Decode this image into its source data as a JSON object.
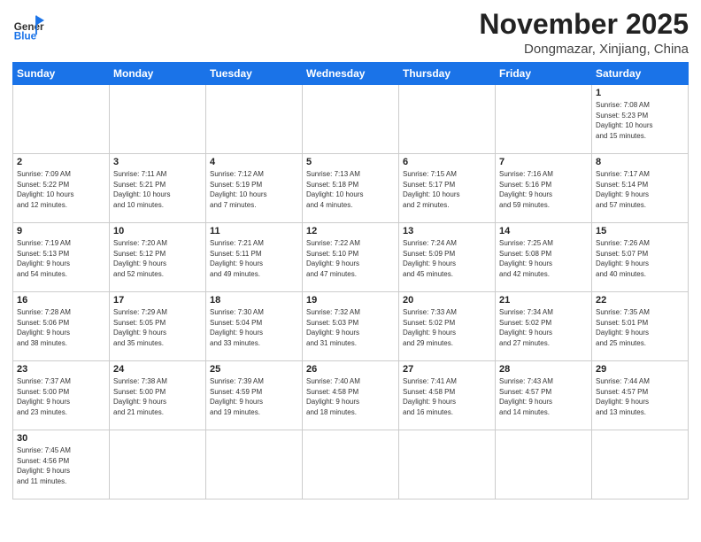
{
  "logo": {
    "text_general": "General",
    "text_blue": "Blue"
  },
  "title": "November 2025",
  "location": "Dongmazar, Xinjiang, China",
  "weekdays": [
    "Sunday",
    "Monday",
    "Tuesday",
    "Wednesday",
    "Thursday",
    "Friday",
    "Saturday"
  ],
  "weeks": [
    [
      {
        "day": "",
        "info": ""
      },
      {
        "day": "",
        "info": ""
      },
      {
        "day": "",
        "info": ""
      },
      {
        "day": "",
        "info": ""
      },
      {
        "day": "",
        "info": ""
      },
      {
        "day": "",
        "info": ""
      },
      {
        "day": "1",
        "info": "Sunrise: 7:08 AM\nSunset: 5:23 PM\nDaylight: 10 hours\nand 15 minutes."
      }
    ],
    [
      {
        "day": "2",
        "info": "Sunrise: 7:09 AM\nSunset: 5:22 PM\nDaylight: 10 hours\nand 12 minutes."
      },
      {
        "day": "3",
        "info": "Sunrise: 7:11 AM\nSunset: 5:21 PM\nDaylight: 10 hours\nand 10 minutes."
      },
      {
        "day": "4",
        "info": "Sunrise: 7:12 AM\nSunset: 5:19 PM\nDaylight: 10 hours\nand 7 minutes."
      },
      {
        "day": "5",
        "info": "Sunrise: 7:13 AM\nSunset: 5:18 PM\nDaylight: 10 hours\nand 4 minutes."
      },
      {
        "day": "6",
        "info": "Sunrise: 7:15 AM\nSunset: 5:17 PM\nDaylight: 10 hours\nand 2 minutes."
      },
      {
        "day": "7",
        "info": "Sunrise: 7:16 AM\nSunset: 5:16 PM\nDaylight: 9 hours\nand 59 minutes."
      },
      {
        "day": "8",
        "info": "Sunrise: 7:17 AM\nSunset: 5:14 PM\nDaylight: 9 hours\nand 57 minutes."
      }
    ],
    [
      {
        "day": "9",
        "info": "Sunrise: 7:19 AM\nSunset: 5:13 PM\nDaylight: 9 hours\nand 54 minutes."
      },
      {
        "day": "10",
        "info": "Sunrise: 7:20 AM\nSunset: 5:12 PM\nDaylight: 9 hours\nand 52 minutes."
      },
      {
        "day": "11",
        "info": "Sunrise: 7:21 AM\nSunset: 5:11 PM\nDaylight: 9 hours\nand 49 minutes."
      },
      {
        "day": "12",
        "info": "Sunrise: 7:22 AM\nSunset: 5:10 PM\nDaylight: 9 hours\nand 47 minutes."
      },
      {
        "day": "13",
        "info": "Sunrise: 7:24 AM\nSunset: 5:09 PM\nDaylight: 9 hours\nand 45 minutes."
      },
      {
        "day": "14",
        "info": "Sunrise: 7:25 AM\nSunset: 5:08 PM\nDaylight: 9 hours\nand 42 minutes."
      },
      {
        "day": "15",
        "info": "Sunrise: 7:26 AM\nSunset: 5:07 PM\nDaylight: 9 hours\nand 40 minutes."
      }
    ],
    [
      {
        "day": "16",
        "info": "Sunrise: 7:28 AM\nSunset: 5:06 PM\nDaylight: 9 hours\nand 38 minutes."
      },
      {
        "day": "17",
        "info": "Sunrise: 7:29 AM\nSunset: 5:05 PM\nDaylight: 9 hours\nand 35 minutes."
      },
      {
        "day": "18",
        "info": "Sunrise: 7:30 AM\nSunset: 5:04 PM\nDaylight: 9 hours\nand 33 minutes."
      },
      {
        "day": "19",
        "info": "Sunrise: 7:32 AM\nSunset: 5:03 PM\nDaylight: 9 hours\nand 31 minutes."
      },
      {
        "day": "20",
        "info": "Sunrise: 7:33 AM\nSunset: 5:02 PM\nDaylight: 9 hours\nand 29 minutes."
      },
      {
        "day": "21",
        "info": "Sunrise: 7:34 AM\nSunset: 5:02 PM\nDaylight: 9 hours\nand 27 minutes."
      },
      {
        "day": "22",
        "info": "Sunrise: 7:35 AM\nSunset: 5:01 PM\nDaylight: 9 hours\nand 25 minutes."
      }
    ],
    [
      {
        "day": "23",
        "info": "Sunrise: 7:37 AM\nSunset: 5:00 PM\nDaylight: 9 hours\nand 23 minutes."
      },
      {
        "day": "24",
        "info": "Sunrise: 7:38 AM\nSunset: 5:00 PM\nDaylight: 9 hours\nand 21 minutes."
      },
      {
        "day": "25",
        "info": "Sunrise: 7:39 AM\nSunset: 4:59 PM\nDaylight: 9 hours\nand 19 minutes."
      },
      {
        "day": "26",
        "info": "Sunrise: 7:40 AM\nSunset: 4:58 PM\nDaylight: 9 hours\nand 18 minutes."
      },
      {
        "day": "27",
        "info": "Sunrise: 7:41 AM\nSunset: 4:58 PM\nDaylight: 9 hours\nand 16 minutes."
      },
      {
        "day": "28",
        "info": "Sunrise: 7:43 AM\nSunset: 4:57 PM\nDaylight: 9 hours\nand 14 minutes."
      },
      {
        "day": "29",
        "info": "Sunrise: 7:44 AM\nSunset: 4:57 PM\nDaylight: 9 hours\nand 13 minutes."
      }
    ],
    [
      {
        "day": "30",
        "info": "Sunrise: 7:45 AM\nSunset: 4:56 PM\nDaylight: 9 hours\nand 11 minutes."
      },
      {
        "day": "",
        "info": ""
      },
      {
        "day": "",
        "info": ""
      },
      {
        "day": "",
        "info": ""
      },
      {
        "day": "",
        "info": ""
      },
      {
        "day": "",
        "info": ""
      },
      {
        "day": "",
        "info": ""
      }
    ]
  ]
}
